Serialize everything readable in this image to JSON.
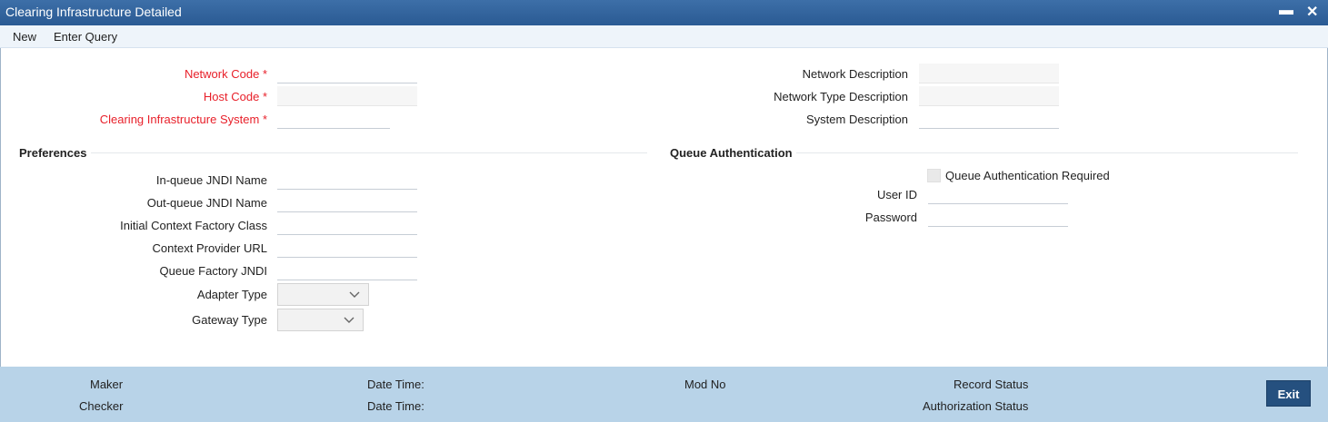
{
  "window": {
    "title": "Clearing Infrastructure Detailed",
    "minimize_glyph": "▬",
    "close_glyph": "✕"
  },
  "menu": {
    "items": [
      "New",
      "Enter Query"
    ]
  },
  "form": {
    "network_code": {
      "label": "Network Code",
      "value": ""
    },
    "host_code": {
      "label": "Host Code",
      "value": ""
    },
    "clearing_system": {
      "label": "Clearing Infrastructure System",
      "value": ""
    },
    "required_marker": "*",
    "network_description": {
      "label": "Network Description",
      "value": ""
    },
    "network_type_description": {
      "label": "Network Type Description",
      "value": ""
    },
    "system_description": {
      "label": "System Description",
      "value": ""
    }
  },
  "preferences": {
    "title": "Preferences",
    "inqueue_jndi": {
      "label": "In-queue JNDI Name",
      "value": ""
    },
    "outqueue_jndi": {
      "label": "Out-queue JNDI Name",
      "value": ""
    },
    "initial_context_factory": {
      "label": "Initial Context Factory Class",
      "value": ""
    },
    "context_provider_url": {
      "label": "Context Provider URL",
      "value": ""
    },
    "queue_factory_jndi": {
      "label": "Queue Factory JNDI",
      "value": ""
    },
    "adapter_type": {
      "label": "Adapter Type",
      "value": ""
    },
    "gateway_type": {
      "label": "Gateway Type",
      "value": ""
    }
  },
  "queue_auth": {
    "title": "Queue Authentication",
    "required": {
      "label": "Queue Authentication Required",
      "checked": false
    },
    "user_id": {
      "label": "User ID",
      "value": ""
    },
    "password": {
      "label": "Password",
      "value": ""
    }
  },
  "footer": {
    "maker": "Maker",
    "checker": "Checker",
    "date_time_1": "Date Time:",
    "date_time_2": "Date Time:",
    "mod_no": "Mod No",
    "record_status": "Record Status",
    "authorization_status": "Authorization Status",
    "exit_label": "Exit"
  },
  "colors": {
    "title_bar": "#2f5f98",
    "required": "#e8202a",
    "footer": "#b8d3e8",
    "exit_button": "#25507f"
  }
}
